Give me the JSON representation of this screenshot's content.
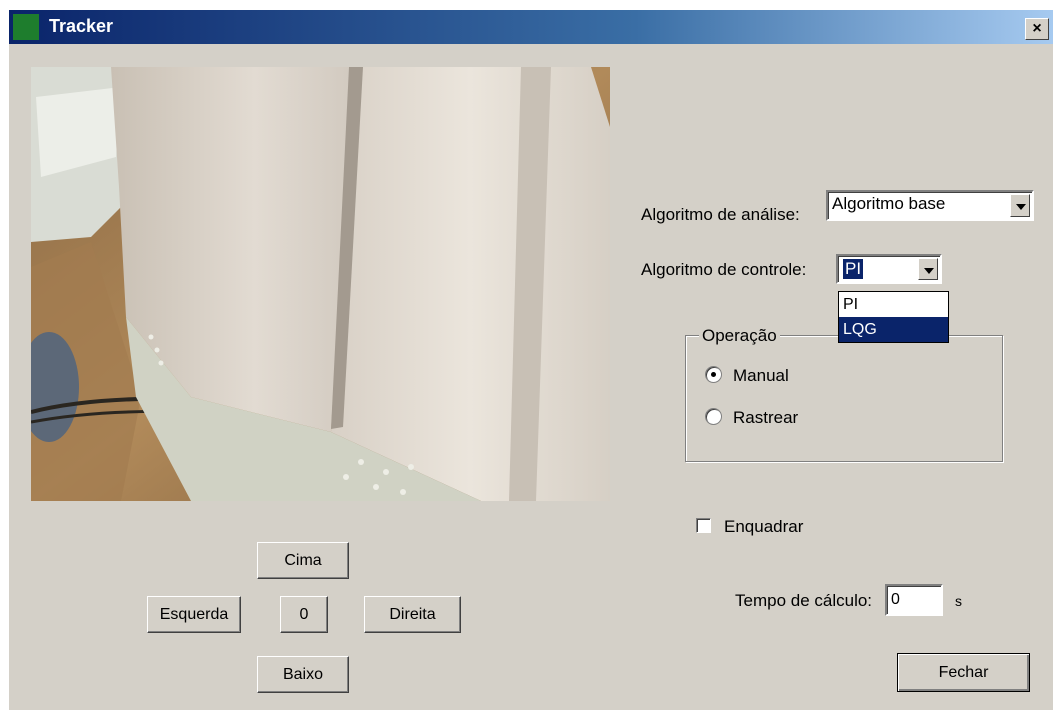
{
  "window": {
    "title": "Tracker",
    "close_label": "×"
  },
  "controls": {
    "analysis_label": "Algoritmo de análise:",
    "analysis_value": "Algoritmo base",
    "control_label": "Algoritmo de controle:",
    "control_value": "PI",
    "control_options": [
      "PI",
      "LQG"
    ],
    "control_highlighted": "LQG"
  },
  "operation": {
    "legend": "Operação",
    "options": [
      {
        "label": "Manual",
        "selected": true
      },
      {
        "label": "Rastrear",
        "selected": false
      }
    ]
  },
  "enquadrar": {
    "label": "Enquadrar",
    "checked": false
  },
  "tempo": {
    "label": "Tempo de cálculo:",
    "value": "0",
    "unit": "s"
  },
  "navigation": {
    "up": "Cima",
    "left": "Esquerda",
    "center": "0",
    "right": "Direita",
    "down": "Baixo"
  },
  "close_button": "Fechar"
}
